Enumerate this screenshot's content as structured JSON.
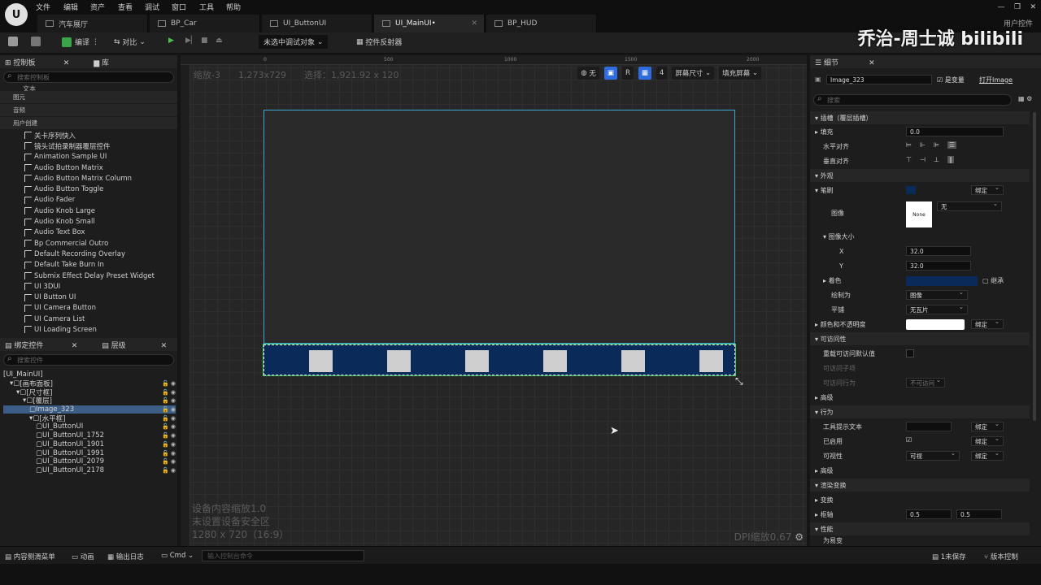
{
  "menu": [
    "文件",
    "编辑",
    "资产",
    "查看",
    "调试",
    "窗口",
    "工具",
    "帮助"
  ],
  "tabs": [
    {
      "label": "汽车展厅",
      "active": false
    },
    {
      "label": "BP_Car",
      "active": false
    },
    {
      "label": "UI_ButtonUI",
      "active": false
    },
    {
      "label": "UI_MainUI•",
      "active": true
    },
    {
      "label": "BP_HUD",
      "active": false
    }
  ],
  "plugin_label": "用户控件",
  "watermark": "乔治-周士诚 bilibili",
  "toolbar": {
    "compile": "编译",
    "diff": "对比",
    "debug_target": "未选中调试对象",
    "widget_reflector": "控件反射器"
  },
  "palette": {
    "title": "控制板",
    "library_tab": "库",
    "search_placeholder": "搜索控制板",
    "partial_item": "文本",
    "categories": [
      "图元",
      "音频",
      "用户创建"
    ],
    "items": [
      "关卡序列快入",
      "镜头试拍录制器覆层控件",
      "Animation Sample UI",
      "Audio Button Matrix",
      "Audio Button Matrix Column",
      "Audio Button Toggle",
      "Audio Fader",
      "Audio Knob Large",
      "Audio Knob Small",
      "Audio Text Box",
      "Bp Commercial Outro",
      "Default Recording Overlay",
      "Default Take Burn In",
      "Submix Effect Delay Preset Widget",
      "UI 3DUI",
      "UI Button UI",
      "UI Camera Button",
      "UI Camera List",
      "UI Loading Screen"
    ]
  },
  "hierarchy": {
    "bind_tab": "绑定控件",
    "title": "层级",
    "search_placeholder": "搜索控件",
    "nodes": [
      {
        "label": "[UI_MainUI]",
        "indent": 0,
        "selected": false
      },
      {
        "label": "[画布面板]",
        "indent": 1,
        "selected": false
      },
      {
        "label": "[尺寸框]",
        "indent": 2,
        "selected": false
      },
      {
        "label": "[覆层]",
        "indent": 3,
        "selected": false
      },
      {
        "label": "Image_323",
        "indent": 4,
        "selected": true
      },
      {
        "label": "[水平框]",
        "indent": 4,
        "selected": false
      },
      {
        "label": "UI_ButtonUI",
        "indent": 5,
        "selected": false
      },
      {
        "label": "UI_ButtonUI_1752",
        "indent": 5,
        "selected": false
      },
      {
        "label": "UI_ButtonUI_1901",
        "indent": 5,
        "selected": false
      },
      {
        "label": "UI_ButtonUI_1991",
        "indent": 5,
        "selected": false
      },
      {
        "label": "UI_ButtonUI_2079",
        "indent": 5,
        "selected": false
      },
      {
        "label": "UI_ButtonUI_2178",
        "indent": 5,
        "selected": false
      }
    ]
  },
  "designer": {
    "zoom": "缩放-3",
    "size": "1,273x729",
    "selection": "选择：1,921.92 x 120",
    "ruler": [
      "0",
      "500",
      "1000",
      "1500",
      "2000"
    ],
    "none_label": "无",
    "r_label": "R",
    "grid_count": "4",
    "screen_size": "屏幕尺寸",
    "fill_screen": "填充屏幕",
    "device_scale": "设备内容缩放1.0",
    "safe_zone": "未设置设备安全区",
    "resolution": "1280 x 720（16:9）",
    "dpi": "DPI缩放0.67",
    "button_count": 6,
    "bar_color": "#0a2a5a"
  },
  "details": {
    "title": "细节",
    "name": "Image_323",
    "is_variable": "是变量",
    "open_image": "打开Image",
    "search_placeholder": "搜索",
    "slot_section": "插槽（覆层插槽）",
    "padding_label": "填充",
    "padding_value": "0.0",
    "h_align": "水平对齐",
    "v_align": "垂直对齐",
    "appearance": "外观",
    "brush": "笔刷",
    "bind": "绑定",
    "image_label": "图像",
    "image_none": "None",
    "image_dd": "无",
    "image_size": "图像大小",
    "x_label": "X",
    "x_value": "32.0",
    "y_label": "Y",
    "y_value": "32.0",
    "tint": "着色",
    "inherit": "继承",
    "draw_as": "绘制为",
    "draw_as_value": "图像",
    "tiling": "平铺",
    "tiling_value": "无瓦片",
    "color_opacity": "颜色和不透明度",
    "accessibility": "可访问性",
    "override_access": "重载可访问默认值",
    "children_access": "可访问子项",
    "access_behavior": "可访问行为",
    "access_value": "不可访问",
    "advanced": "高级",
    "behavior": "行为",
    "tooltip": "工具提示文本",
    "enabled": "已启用",
    "visibility": "可视性",
    "visibility_value": "可视",
    "render_transform": "渲染变换",
    "transform": "变换",
    "pivot": "枢轴",
    "pivot_x": "0.5",
    "pivot_y": "0.5",
    "performance": "性能",
    "volatile": "为易变",
    "brush_color": "#0a2a5a"
  },
  "status": {
    "drawer": "内容侧滑菜单",
    "anim": "动画",
    "log": "输出日志",
    "cmd": "Cmd",
    "cmd_placeholder": "输入控制台命令",
    "unsaved": "1未保存",
    "source": "版本控制"
  }
}
